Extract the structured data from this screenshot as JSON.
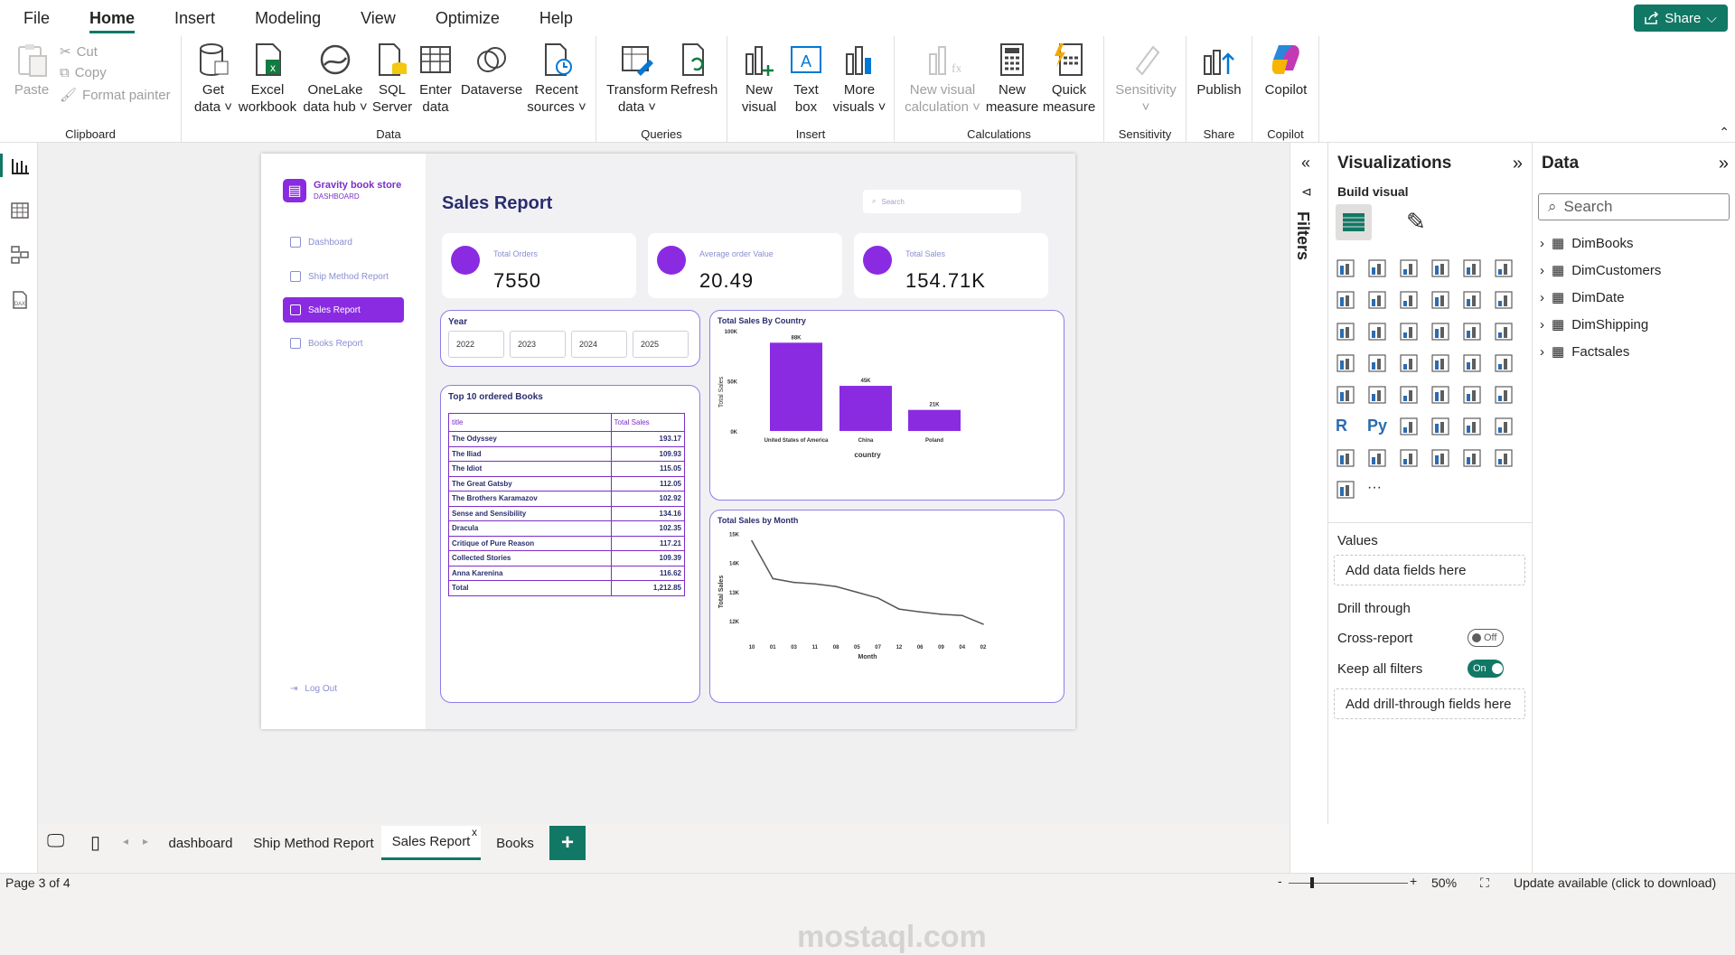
{
  "menu": {
    "items": [
      "File",
      "Home",
      "Insert",
      "Modeling",
      "View",
      "Optimize",
      "Help"
    ],
    "share": "Share"
  },
  "ribbon": {
    "clipboard": {
      "label": "Clipboard",
      "paste": "Paste",
      "cut": "Cut",
      "copy": "Copy",
      "format_painter": "Format painter"
    },
    "data": {
      "label": "Data",
      "buttons": [
        {
          "l1": "Get",
          "l2": "data ˅"
        },
        {
          "l1": "Excel",
          "l2": "workbook"
        },
        {
          "l1": "OneLake",
          "l2": "data hub ˅"
        },
        {
          "l1": "SQL",
          "l2": "Server"
        },
        {
          "l1": "Enter",
          "l2": "data"
        },
        {
          "l1": "Dataverse",
          "l2": ""
        },
        {
          "l1": "Recent",
          "l2": "sources ˅"
        }
      ]
    },
    "queries": {
      "label": "Queries",
      "buttons": [
        {
          "l1": "Transform",
          "l2": "data ˅"
        },
        {
          "l1": "Refresh",
          "l2": ""
        }
      ]
    },
    "insert": {
      "label": "Insert",
      "buttons": [
        {
          "l1": "New",
          "l2": "visual"
        },
        {
          "l1": "Text",
          "l2": "box"
        },
        {
          "l1": "More",
          "l2": "visuals ˅"
        }
      ]
    },
    "calculations": {
      "label": "Calculations",
      "buttons": [
        {
          "l1": "New visual",
          "l2": "calculation ˅"
        },
        {
          "l1": "New",
          "l2": "measure"
        },
        {
          "l1": "Quick",
          "l2": "measure"
        }
      ]
    },
    "sensitivity": {
      "label": "Sensitivity",
      "button": "Sensitivity"
    },
    "share": {
      "label": "Share",
      "button": "Publish"
    },
    "copilot": {
      "label": "Copilot",
      "button": "Copilot"
    }
  },
  "report": {
    "brand": {
      "title": "Gravity book store",
      "subtitle": "DASHBOARD"
    },
    "nav": [
      "Dashboard",
      "Ship Method Report",
      "Sales Report",
      "Books Report"
    ],
    "logout": "Log Out",
    "title": "Sales Report",
    "search_placeholder": "Search",
    "cards": [
      {
        "label": "Total Orders",
        "value": "7550"
      },
      {
        "label": "Average order Value",
        "value": "20.49"
      },
      {
        "label": "Total Sales",
        "value": "154.71K"
      }
    ],
    "year": {
      "title": "Year",
      "options": [
        "2022",
        "2023",
        "2024",
        "2025"
      ]
    },
    "books": {
      "title": "Top 10 ordered Books",
      "headers": [
        "title",
        "Total Sales"
      ],
      "rows": [
        [
          "The Odyssey",
          "193.17"
        ],
        [
          "The Iliad",
          "109.93"
        ],
        [
          "The Idiot",
          "115.05"
        ],
        [
          "The Great Gatsby",
          "112.05"
        ],
        [
          "The Brothers Karamazov",
          "102.92"
        ],
        [
          "Sense and Sensibility",
          "134.16"
        ],
        [
          "Dracula",
          "102.35"
        ],
        [
          "Critique of Pure Reason",
          "117.21"
        ],
        [
          "Collected Stories",
          "109.39"
        ],
        [
          "Anna Karenina",
          "116.62"
        ],
        [
          "Total",
          "1,212.85"
        ]
      ]
    }
  },
  "chart_data": [
    {
      "type": "bar",
      "title": "Total Sales By Country",
      "xlabel": "country",
      "ylabel": "Total Sales",
      "categories": [
        "United States of America",
        "China",
        "Poland"
      ],
      "values": [
        88,
        45,
        21
      ],
      "data_labels": [
        "88K",
        "45K",
        "21K"
      ],
      "yticks": [
        "100K",
        "50K",
        "0K"
      ],
      "ylim": [
        0,
        100
      ],
      "color": "#8a2be2"
    },
    {
      "type": "line",
      "title": "Total Sales by Month",
      "xlabel": "Month",
      "ylabel": "Total Sales",
      "categories": [
        "10",
        "01",
        "03",
        "11",
        "08",
        "05",
        "07",
        "12",
        "06",
        "09",
        "04",
        "02"
      ],
      "values": [
        14.75,
        13.45,
        13.32,
        13.27,
        13.18,
        12.98,
        12.78,
        12.4,
        12.3,
        12.22,
        12.18,
        11.88
      ],
      "yticks": [
        "15K",
        "14K",
        "13K",
        "12K"
      ],
      "ylim": [
        11.75,
        15.05
      ],
      "color": "#555555"
    }
  ],
  "panes": {
    "filters": "Filters",
    "visualizations": {
      "title": "Visualizations",
      "build": "Build visual",
      "values": "Values",
      "add_fields": "Add data fields here",
      "drill": "Drill through",
      "cross": "Cross-report",
      "cross_state": "Off",
      "keep": "Keep all filters",
      "keep_state": "On",
      "add_drill": "Add drill-through fields here"
    },
    "data": {
      "title": "Data",
      "search": "Search",
      "tables": [
        "DimBooks",
        "DimCustomers",
        "DimDate",
        "DimShipping",
        "Factsales"
      ]
    }
  },
  "tabs": [
    "dashboard",
    "Ship Method Report",
    "Sales Report",
    "Books"
  ],
  "status": {
    "page": "Page 3 of 4",
    "zoom": "50%",
    "update": "Update available (click to download)"
  },
  "watermark": "mostaql.com",
  "colors": {
    "accent": "#117865",
    "purple": "#8a2be2",
    "navy": "#2a2d6e"
  }
}
